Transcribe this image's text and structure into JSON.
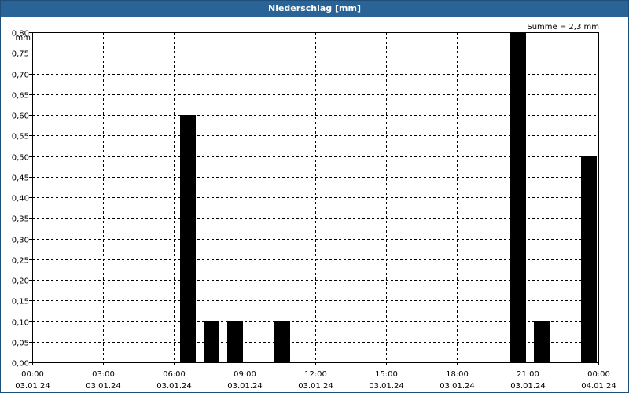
{
  "window": {
    "title": "Niederschlag [mm]"
  },
  "summary": "Summe = 2,3 mm",
  "chart_data": {
    "type": "bar",
    "title": "Niederschlag [mm]",
    "ylabel": "mm",
    "ylim": [
      0,
      0.8
    ],
    "grid": true,
    "y_ticks": [
      "0,00",
      "0,05",
      "0,10",
      "0,15",
      "0,20",
      "0,25",
      "0,30",
      "0,35",
      "0,40",
      "0,45",
      "0,50",
      "0,55",
      "0,60",
      "0,65",
      "0,70",
      "0,75",
      "0,80"
    ],
    "x_ticks": [
      {
        "time": "00:00",
        "date": "03.01.24"
      },
      {
        "time": "03:00",
        "date": "03.01.24"
      },
      {
        "time": "06:00",
        "date": "03.01.24"
      },
      {
        "time": "09:00",
        "date": "03.01.24"
      },
      {
        "time": "12:00",
        "date": "03.01.24"
      },
      {
        "time": "15:00",
        "date": "03.01.24"
      },
      {
        "time": "18:00",
        "date": "03.01.24"
      },
      {
        "time": "21:00",
        "date": "03.01.24"
      },
      {
        "time": "00:00",
        "date": "04.01.24"
      }
    ],
    "x_range": [
      "03.01.24 00:00",
      "04.01.24 00:00"
    ],
    "bar_color": "#000000",
    "points": [
      {
        "x": "03.01.24 06:00",
        "value": 0.6
      },
      {
        "x": "03.01.24 07:00",
        "value": 0.1
      },
      {
        "x": "03.01.24 08:00",
        "value": 0.1
      },
      {
        "x": "03.01.24 10:00",
        "value": 0.1
      },
      {
        "x": "03.01.24 20:00",
        "value": 0.8
      },
      {
        "x": "03.01.24 21:00",
        "value": 0.1
      },
      {
        "x": "03.01.24 23:00",
        "value": 0.5
      }
    ],
    "summary": "Summe = 2,3 mm"
  }
}
